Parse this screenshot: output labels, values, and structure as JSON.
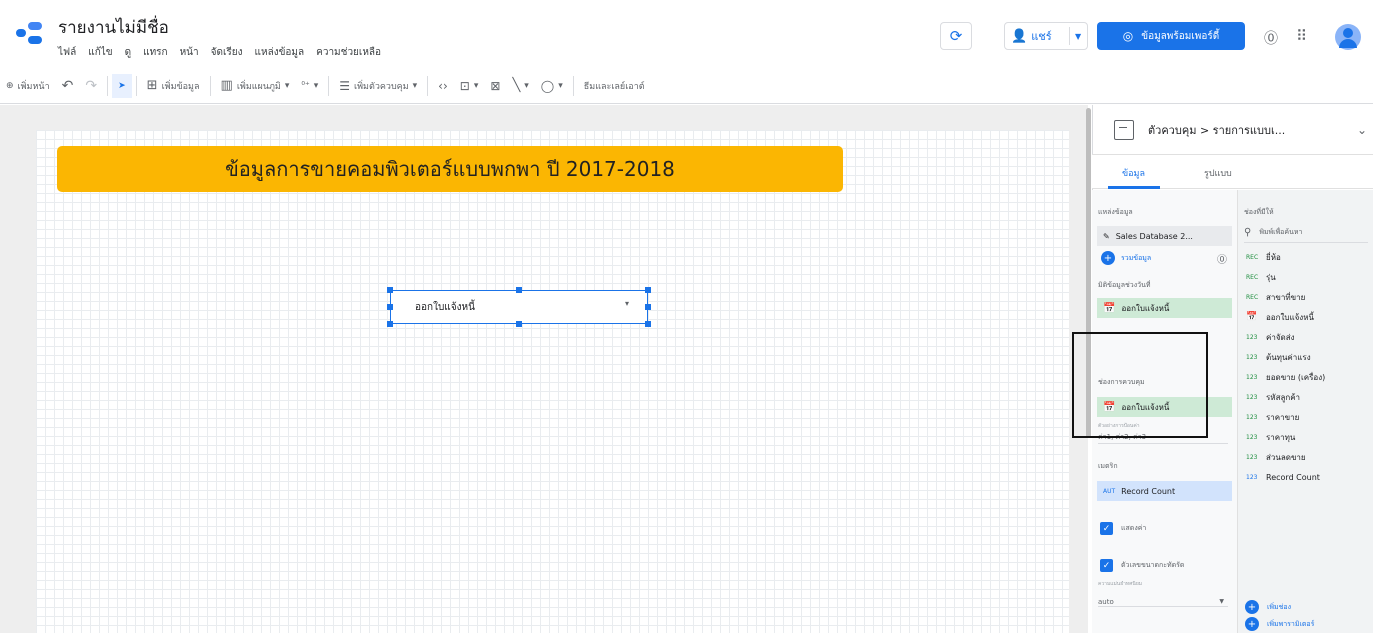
{
  "header": {
    "title": "รายงานไม่มีชื่อ",
    "menu": [
      "ไฟล์",
      "แก้ไข",
      "ดู",
      "แทรก",
      "หน้า",
      "จัดเรียง",
      "แหล่งข้อมูล",
      "ความช่วยเหลือ"
    ],
    "share_label": "แชร์",
    "data_button_label": "ข้อมูลพร้อมเพอร์ดี้"
  },
  "toolbar": {
    "add_page": "เพิ่มหน้า",
    "add_data": "เพิ่มข้อมูล",
    "add_chart": "เพิ่มแผนภูมิ",
    "add_control": "เพิ่มตัวควบคุม",
    "theme_layout": "ธีมและเลย์เอาต์"
  },
  "canvas": {
    "banner_title": "ข้อมูลการขายคอมพิวเตอร์แบบพกพา ปี 2017-2018",
    "control_label": "ออกใบแจ้งหนี้"
  },
  "panel": {
    "breadcrumb": "ตัวควบคุม > รายการแบบเ...",
    "tab_data": "ข้อมูล",
    "tab_style": "รูปแบบ",
    "data_source_label": "แหล่งข้อมูล",
    "data_source_name": "Sales Database 2...",
    "add_data_link": "รวมข้อมูล",
    "date_range_dimension_label": "มิติข้อมูลช่วงวันที่",
    "date_range_dimension": "ออกใบแจ้งหนี้",
    "control_field_label": "ช่องการควบคุม",
    "control_field": "ออกใบแจ้งหนี้",
    "example_label": "ตัวอย่างการป้อนค่า",
    "example_value": "ค่า1, ค่า2, ค่า3",
    "metric_label": "เมตริก",
    "metric_type": "AUT",
    "metric_value": "Record Count",
    "show_values_label": "แสดงค่า",
    "compact_numbers_label": "ตัวเลขขนาดกะทัดรัด",
    "decimal_precision_label": "ความแม่นยำทศนิยม",
    "decimal_precision_value": "auto",
    "available_fields_label": "ช่องที่มีให้",
    "search_placeholder": "พิมพ์เพื่อค้นหา",
    "fields": [
      {
        "type": "REC",
        "name": "ยี่ห้อ"
      },
      {
        "type": "REC",
        "name": "รุ่น"
      },
      {
        "type": "REC",
        "name": "สาขาที่ขาย"
      },
      {
        "type": "DATE",
        "name": "ออกใบแจ้งหนี้"
      },
      {
        "type": "123",
        "name": "ค่าจัดส่ง"
      },
      {
        "type": "123",
        "name": "ต้นทุนค่าแรง"
      },
      {
        "type": "123",
        "name": "ยอดขาย (เครื่อง)"
      },
      {
        "type": "123",
        "name": "รหัสลูกค้า"
      },
      {
        "type": "123",
        "name": "ราคาขาย"
      },
      {
        "type": "123",
        "name": "ราคาทุน"
      },
      {
        "type": "123",
        "name": "ส่วนลดขาย"
      },
      {
        "type": "123",
        "name": "Record Count"
      }
    ],
    "add_field": "เพิ่มช่อง",
    "add_parameter": "เพิ่มพารามิเตอร์"
  },
  "colors": {
    "accent": "#1a73e8",
    "banner": "#fbb602",
    "dimension_bg": "#ceead6"
  }
}
